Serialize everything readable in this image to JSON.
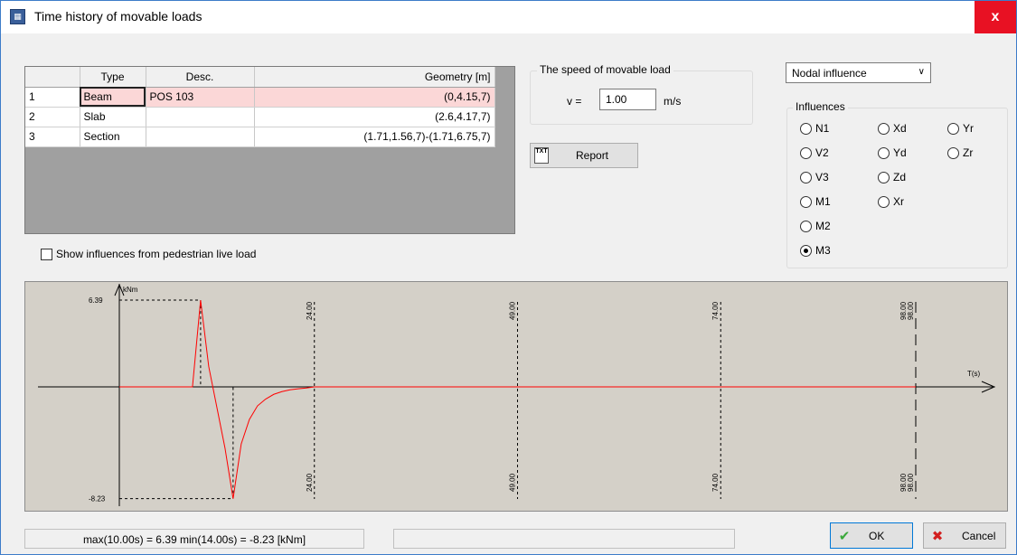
{
  "window": {
    "title": "Time history of movable loads",
    "close": "x"
  },
  "grid": {
    "headers": [
      "",
      "Type",
      "Desc.",
      "Geometry [m]"
    ],
    "rows": [
      {
        "num": "1",
        "type": "Beam",
        "desc": "POS 103",
        "geometry": "(0,4.15,7)"
      },
      {
        "num": "2",
        "type": "Slab",
        "desc": "",
        "geometry": "(2.6,4.17,7)"
      },
      {
        "num": "3",
        "type": "Section",
        "desc": "",
        "geometry": "(1.71,1.56,7)-(1.71,6.75,7)"
      }
    ]
  },
  "pedestrian_checkbox": {
    "label": "Show influences from pedestrian live load",
    "checked": false
  },
  "speed": {
    "title": "The speed of movable load",
    "label": "v =",
    "value": "1.00",
    "unit": "m/s"
  },
  "report": {
    "label": "Report",
    "icon": "txt-report-icon",
    "icon_text": "TXT"
  },
  "influence_mode": {
    "selected": "Nodal influence"
  },
  "influences": {
    "title": "Influences",
    "options": [
      "N1",
      "V2",
      "V3",
      "M1",
      "M2",
      "M3",
      "Xd",
      "Yd",
      "Zd",
      "Xr",
      "Yr",
      "Zr"
    ],
    "selected": "M3"
  },
  "chart_data": {
    "type": "line",
    "ylabel": "kNm",
    "xlabel": "T(s)",
    "y_max_label": "6.39",
    "y_min_label": "-8.23",
    "markers": [
      "24.00",
      "49.00",
      "74.00",
      "98.00"
    ],
    "end_marker_pair": [
      "98.00",
      "98.00"
    ],
    "x_range": [
      0,
      98
    ],
    "series": [
      {
        "color": "#ff0000",
        "x": [
          0,
          9,
          10,
          11,
          12,
          13,
          14,
          15,
          16,
          17,
          18,
          19,
          20,
          21,
          22,
          23,
          24,
          98
        ],
        "y": [
          0,
          0,
          6.39,
          1.5,
          -1.5,
          -4.5,
          -8.23,
          -4.2,
          -2.4,
          -1.4,
          -0.9,
          -0.55,
          -0.35,
          -0.22,
          -0.14,
          -0.08,
          0,
          0
        ]
      }
    ]
  },
  "status": {
    "left": "max(10.00s) = 6.39  min(14.00s) = -8.23 [kNm]",
    "right": ""
  },
  "buttons": {
    "ok": "OK",
    "cancel": "Cancel"
  }
}
